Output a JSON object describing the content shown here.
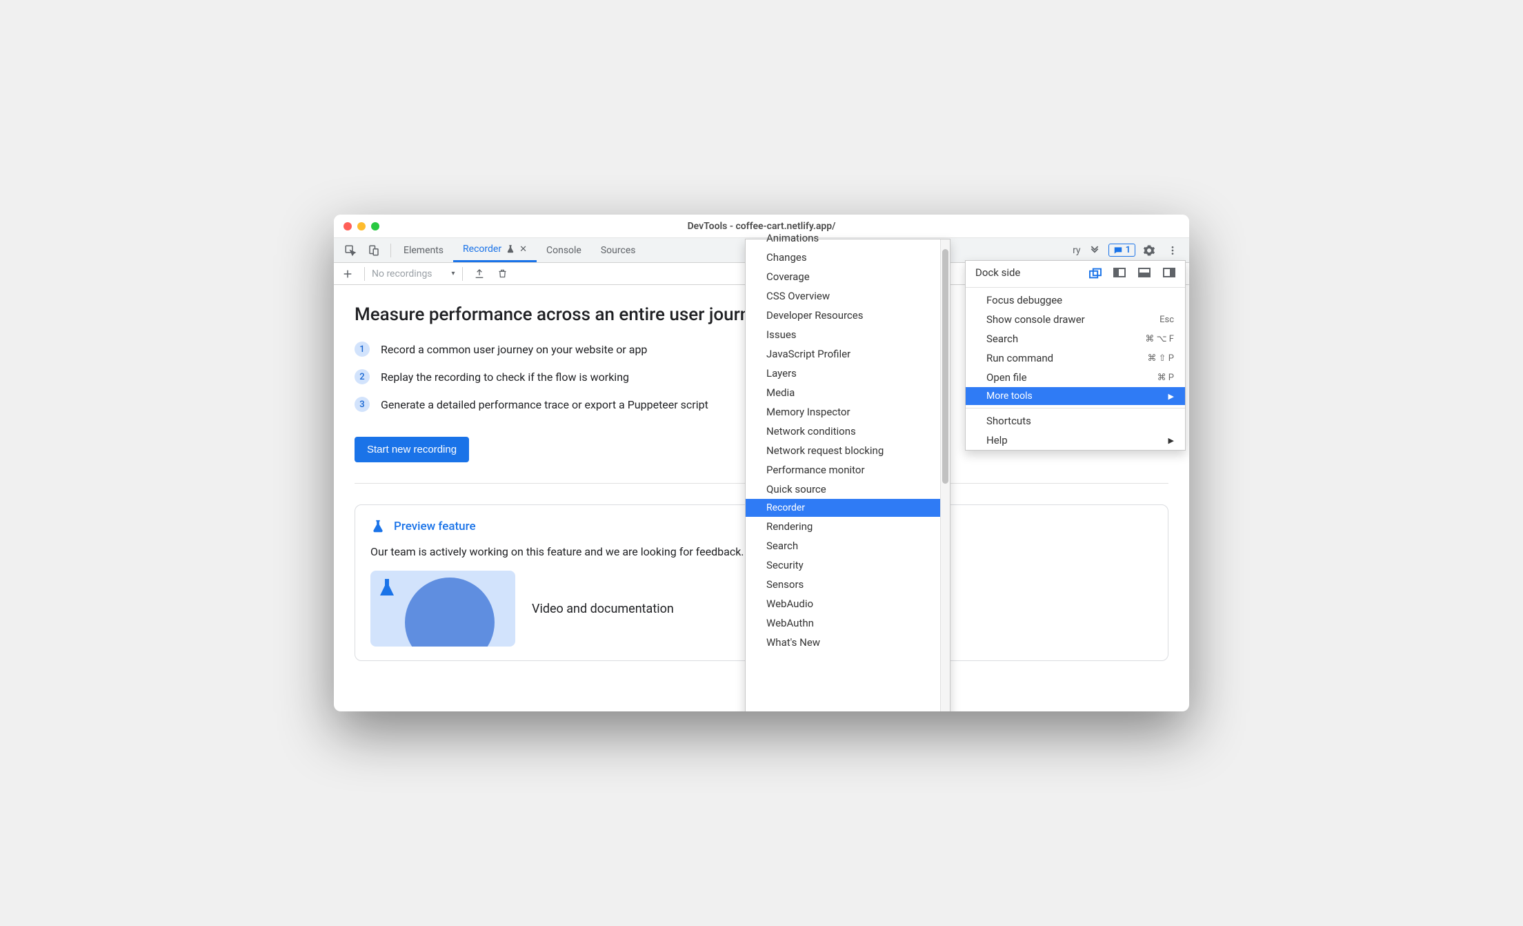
{
  "window": {
    "title": "DevTools - coffee-cart.netlify.app/"
  },
  "tabstrip": {
    "tabs": [
      {
        "label": "Elements"
      },
      {
        "label": "Recorder"
      },
      {
        "label": "Console"
      },
      {
        "label": "Sources"
      }
    ],
    "overflow_hint": "ry",
    "message_count": "1"
  },
  "recorder_toolbar": {
    "select_placeholder": "No recordings"
  },
  "main": {
    "heading": "Measure performance across an entire user journey",
    "steps": [
      "Record a common user journey on your website or app",
      "Replay the recording to check if the flow is working",
      "Generate a detailed performance trace or export a Puppeteer script"
    ],
    "start_button": "Start new recording",
    "preview": {
      "title": "Preview feature",
      "body": "Our team is actively working on this feature and we are looking for feedback.",
      "caption": "Video and documentation"
    }
  },
  "submenu": {
    "items": [
      "Animations",
      "Changes",
      "Coverage",
      "CSS Overview",
      "Developer Resources",
      "Issues",
      "JavaScript Profiler",
      "Layers",
      "Media",
      "Memory Inspector",
      "Network conditions",
      "Network request blocking",
      "Performance monitor",
      "Quick source",
      "Recorder",
      "Rendering",
      "Search",
      "Security",
      "Sensors",
      "WebAudio",
      "WebAuthn",
      "What's New"
    ],
    "selected": "Recorder"
  },
  "mainmenu": {
    "dock_label": "Dock side",
    "items": [
      {
        "label": "Focus debuggee",
        "kbd": ""
      },
      {
        "label": "Show console drawer",
        "kbd": "Esc"
      },
      {
        "label": "Search",
        "kbd": "⌘ ⌥ F"
      },
      {
        "label": "Run command",
        "kbd": "⌘ ⇧ P"
      },
      {
        "label": "Open file",
        "kbd": "⌘ P"
      },
      {
        "label": "More tools",
        "kbd": "",
        "arrow": true,
        "selected": true
      }
    ],
    "bottom": [
      {
        "label": "Shortcuts"
      },
      {
        "label": "Help",
        "arrow": true
      }
    ]
  }
}
